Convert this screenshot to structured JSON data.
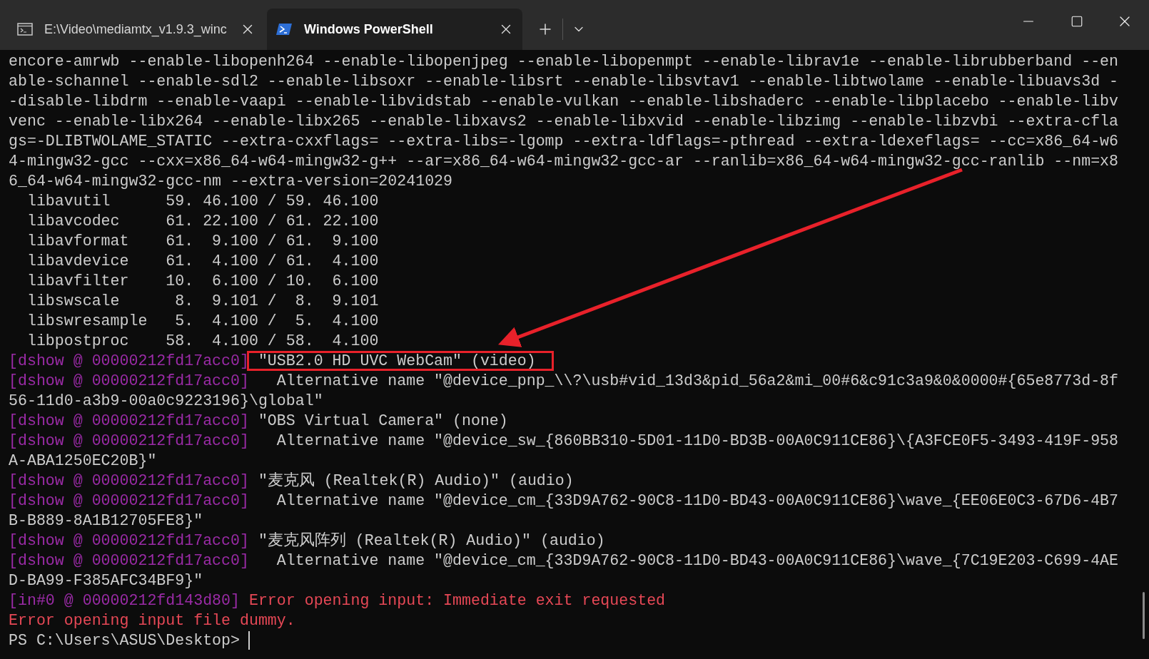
{
  "tabs": [
    {
      "kind": "cmd",
      "title": "E:\\Video\\mediamtx_v1.9.3_winc",
      "selected": false
    },
    {
      "kind": "powershell",
      "title": "Windows PowerShell",
      "selected": true
    }
  ],
  "console": {
    "lines": [
      {
        "segments": [
          {
            "kind": "plain",
            "text": "encore-amrwb --enable-libopenh264 --enable-libopenjpeg --enable-libopenmpt --enable-librav1e --enable-librubberband --en"
          }
        ]
      },
      {
        "segments": [
          {
            "kind": "plain",
            "text": "able-schannel --enable-sdl2 --enable-libsoxr --enable-libsrt --enable-libsvtav1 --enable-libtwolame --enable-libuavs3d -"
          }
        ]
      },
      {
        "segments": [
          {
            "kind": "plain",
            "text": "-disable-libdrm --enable-vaapi --enable-libvidstab --enable-vulkan --enable-libshaderc --enable-libplacebo --enable-libv"
          }
        ]
      },
      {
        "segments": [
          {
            "kind": "plain",
            "text": "venc --enable-libx264 --enable-libx265 --enable-libxavs2 --enable-libxvid --enable-libzimg --enable-libzvbi --extra-cfla"
          }
        ]
      },
      {
        "segments": [
          {
            "kind": "plain",
            "text": "gs=-DLIBTWOLAME_STATIC --extra-cxxflags= --extra-libs=-lgomp --extra-ldflags=-pthread --extra-ldexeflags= --cc=x86_64-w6"
          }
        ]
      },
      {
        "segments": [
          {
            "kind": "plain",
            "text": "4-mingw32-gcc --cxx=x86_64-w64-mingw32-g++ --ar=x86_64-w64-mingw32-gcc-ar --ranlib=x86_64-w64-mingw32-gcc-ranlib --nm=x8"
          }
        ]
      },
      {
        "segments": [
          {
            "kind": "plain",
            "text": "6_64-w64-mingw32-gcc-nm --extra-version=20241029"
          }
        ]
      },
      {
        "segments": [
          {
            "kind": "plain",
            "text": "  libavutil      59. 46.100 / 59. 46.100"
          }
        ]
      },
      {
        "segments": [
          {
            "kind": "plain",
            "text": "  libavcodec     61. 22.100 / 61. 22.100"
          }
        ]
      },
      {
        "segments": [
          {
            "kind": "plain",
            "text": "  libavformat    61.  9.100 / 61.  9.100"
          }
        ]
      },
      {
        "segments": [
          {
            "kind": "plain",
            "text": "  libavdevice    61.  4.100 / 61.  4.100"
          }
        ]
      },
      {
        "segments": [
          {
            "kind": "plain",
            "text": "  libavfilter    10.  6.100 / 10.  6.100"
          }
        ]
      },
      {
        "segments": [
          {
            "kind": "plain",
            "text": "  libswscale      8.  9.101 /  8.  9.101"
          }
        ]
      },
      {
        "segments": [
          {
            "kind": "plain",
            "text": "  libswresample   5.  4.100 /  5.  4.100"
          }
        ]
      },
      {
        "segments": [
          {
            "kind": "plain",
            "text": "  libpostproc    58.  4.100 / 58.  4.100"
          }
        ]
      },
      {
        "segments": [
          {
            "kind": "tag",
            "text": "[dshow @ 00000212fd17acc0]"
          },
          {
            "kind": "plain",
            "text": " \"USB2.0 HD UVC WebCam\" (video)",
            "highlighted": true
          }
        ]
      },
      {
        "segments": [
          {
            "kind": "tag",
            "text": "[dshow @ 00000212fd17acc0]"
          },
          {
            "kind": "plain",
            "text": "   Alternative name \"@device_pnp_\\\\?\\usb#vid_13d3&pid_56a2&mi_00#6&c91c3a9&0&0000#{65e8773d-8f"
          }
        ]
      },
      {
        "segments": [
          {
            "kind": "plain",
            "text": "56-11d0-a3b9-00a0c9223196}\\global\""
          }
        ]
      },
      {
        "segments": [
          {
            "kind": "tag",
            "text": "[dshow @ 00000212fd17acc0]"
          },
          {
            "kind": "plain",
            "text": " \"OBS Virtual Camera\" (none)"
          }
        ]
      },
      {
        "segments": [
          {
            "kind": "tag",
            "text": "[dshow @ 00000212fd17acc0]"
          },
          {
            "kind": "plain",
            "text": "   Alternative name \"@device_sw_{860BB310-5D01-11D0-BD3B-00A0C911CE86}\\{A3FCE0F5-3493-419F-958"
          }
        ]
      },
      {
        "segments": [
          {
            "kind": "plain",
            "text": "A-ABA1250EC20B}\""
          }
        ]
      },
      {
        "segments": [
          {
            "kind": "tag",
            "text": "[dshow @ 00000212fd17acc0]"
          },
          {
            "kind": "plain",
            "text": " \"麦克风 (Realtek(R) Audio)\" (audio)"
          }
        ]
      },
      {
        "segments": [
          {
            "kind": "tag",
            "text": "[dshow @ 00000212fd17acc0]"
          },
          {
            "kind": "plain",
            "text": "   Alternative name \"@device_cm_{33D9A762-90C8-11D0-BD43-00A0C911CE86}\\wave_{EE06E0C3-67D6-4B7"
          }
        ]
      },
      {
        "segments": [
          {
            "kind": "plain",
            "text": "B-B889-8A1B12705FE8}\""
          }
        ]
      },
      {
        "segments": [
          {
            "kind": "tag",
            "text": "[dshow @ 00000212fd17acc0]"
          },
          {
            "kind": "plain",
            "text": " \"麦克风阵列 (Realtek(R) Audio)\" (audio)"
          }
        ]
      },
      {
        "segments": [
          {
            "kind": "tag",
            "text": "[dshow @ 00000212fd17acc0]"
          },
          {
            "kind": "plain",
            "text": "   Alternative name \"@device_cm_{33D9A762-90C8-11D0-BD43-00A0C911CE86}\\wave_{7C19E203-C699-4AE"
          }
        ]
      },
      {
        "segments": [
          {
            "kind": "plain",
            "text": "D-BA99-F385AFC34BF9}\""
          }
        ]
      },
      {
        "segments": [
          {
            "kind": "tag",
            "text": "[in#0 @ 00000212fd143d80]"
          },
          {
            "kind": "error",
            "text": " Error opening input: Immediate exit requested"
          }
        ]
      },
      {
        "segments": [
          {
            "kind": "error",
            "text": "Error opening input file dummy."
          }
        ]
      }
    ],
    "prompt": "PS C:\\Users\\ASUS\\Desktop>"
  }
}
